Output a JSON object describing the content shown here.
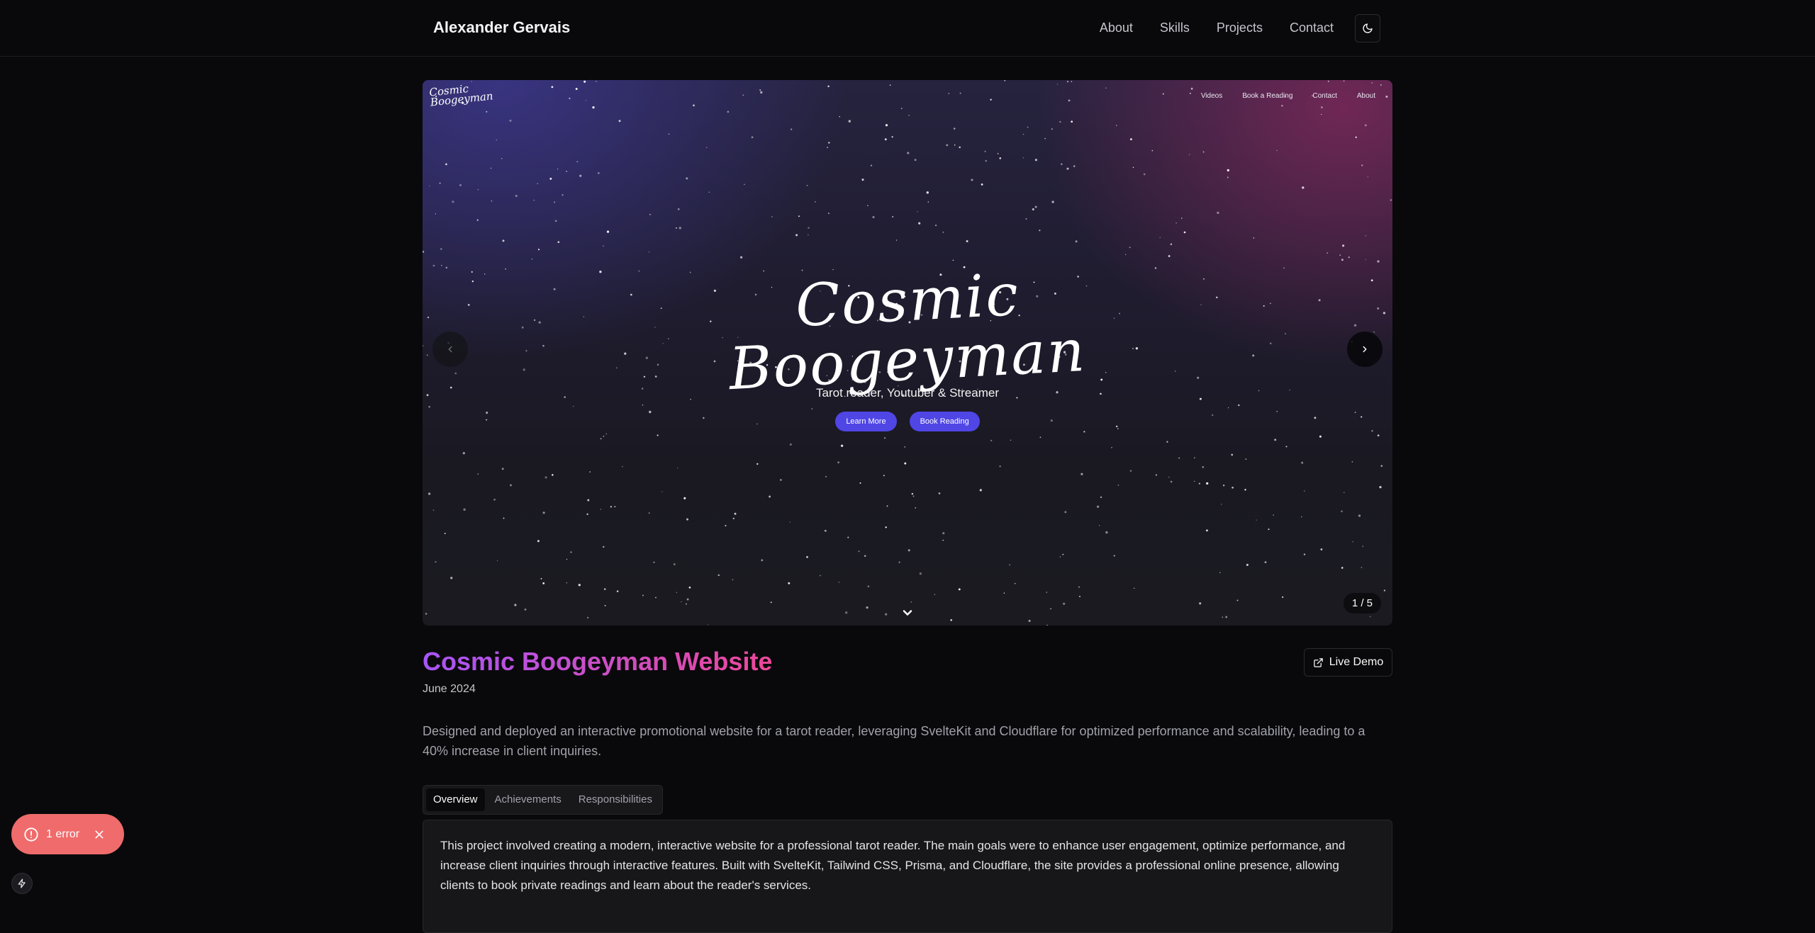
{
  "header": {
    "brand": "Alexander Gervais",
    "nav": [
      "About",
      "Skills",
      "Projects",
      "Contact"
    ],
    "theme_icon": "moon-icon"
  },
  "carousel": {
    "mini_logo_line1": "Cosmic",
    "mini_logo_line2": "Boogeyman",
    "mini_nav": [
      "Videos",
      "Book a Reading",
      "Contact",
      "About"
    ],
    "title_line1": "Cosmic",
    "title_line2": "Boogeyman",
    "tagline": "Tarot reader, Youtuber & Streamer",
    "buttons": [
      "Learn More",
      "Book Reading"
    ],
    "counter": "1 / 5",
    "prev_icon": "chevron-left-icon",
    "next_icon": "chevron-right-icon",
    "scroll_icon": "chevron-down-icon"
  },
  "project": {
    "title": "Cosmic Boogeyman Website",
    "date": "June 2024",
    "live_demo": "Live Demo",
    "description": "Designed and deployed an interactive promotional website for a tarot reader, leveraging SvelteKit and Cloudflare for optimized performance and scalability, leading to a 40% increase in client inquiries.",
    "tabs": [
      "Overview",
      "Achievements",
      "Responsibilities"
    ],
    "active_tab": "Overview",
    "overview": "This project involved creating a modern, interactive website for a professional tarot reader. The main goals were to enhance user engagement, optimize performance, and increase client inquiries through interactive features. Built with SvelteKit, Tailwind CSS, Prisma, and Cloudflare, the site provides a professional online presence, allowing clients to book private readings and learn about the reader's services."
  },
  "dev_overlay": {
    "error_label": "1 error",
    "error_icon": "alert-circle-icon",
    "close_icon": "close-icon",
    "bolt_icon": "bolt-icon"
  }
}
